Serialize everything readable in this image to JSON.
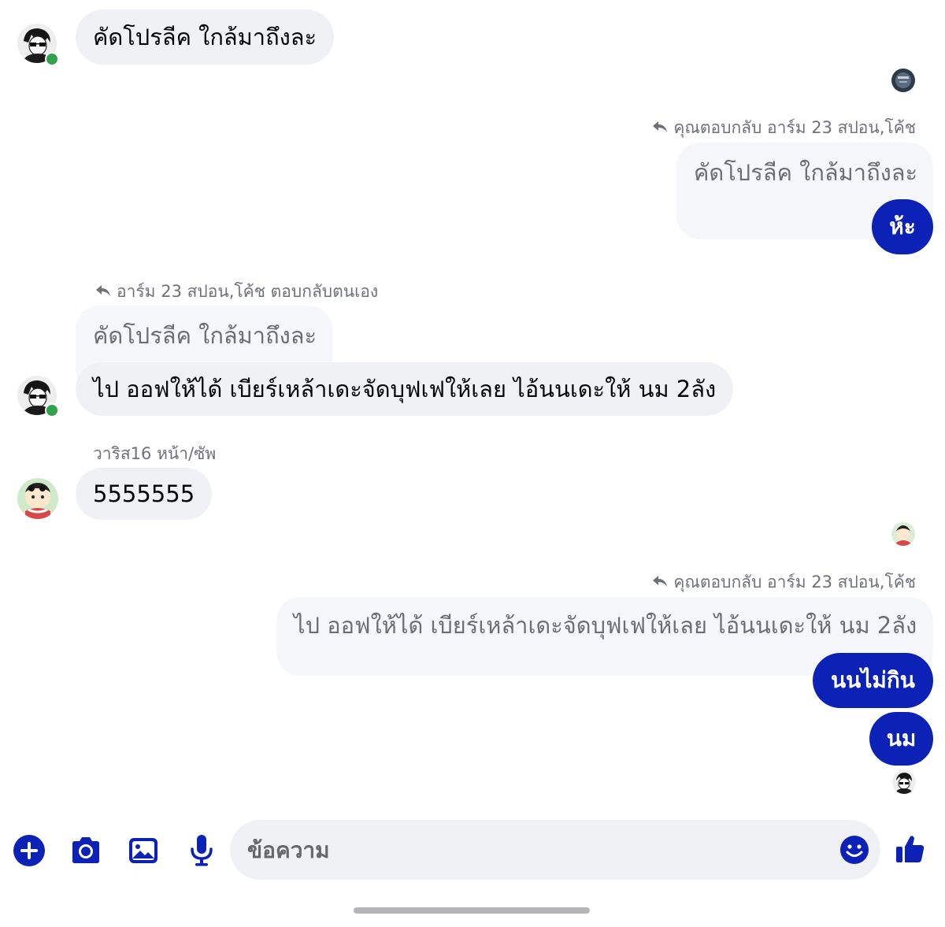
{
  "colors": {
    "accent": "#0c21b5",
    "online": "#31a24c",
    "bubble_in": "#f0f1f5"
  },
  "messages": {
    "m1": {
      "text": "คัดโปรลีค ใกล้มาถึงละ"
    },
    "r1": {
      "meta": "คุณตอบกลับ อาร์ม 23 สปอน,โค้ช",
      "quote": "คัดโปรลีค ใกล้มาถึงละ",
      "reply": "ห้ะ"
    },
    "r2": {
      "meta": "อาร์ม 23 สปอน,โค้ช ตอบกลับตนเอง",
      "quote": "คัดโปรลีค ใกล้มาถึงละ",
      "reply": "ไป ออฟให้ได้ เบียร์เหล้าเดะจัดบุฟเฟให้เลย  ไอ้นนเดะให้ นม 2ลัง"
    },
    "m3": {
      "sender": "วาริส16 หน้า/ซัพ",
      "text": "5555555"
    },
    "r3": {
      "meta": "คุณตอบกลับ อาร์ม 23 สปอน,โค้ช",
      "quote": "ไป ออฟให้ได้ เบียร์เหล้าเดะจัดบุฟเฟให้เลย  ไอ้นนเดะให้ นม 2ลัง",
      "reply1": "นนไม่กิน",
      "reply2": "นม"
    }
  },
  "composer": {
    "placeholder": "ข้อความ"
  },
  "icons": {
    "reply": "reply-arrow-icon",
    "add": "plus-circle-icon",
    "camera": "camera-icon",
    "gallery": "image-icon",
    "mic": "microphone-icon",
    "emoji": "emoji-icon",
    "like": "thumbs-up-icon"
  }
}
